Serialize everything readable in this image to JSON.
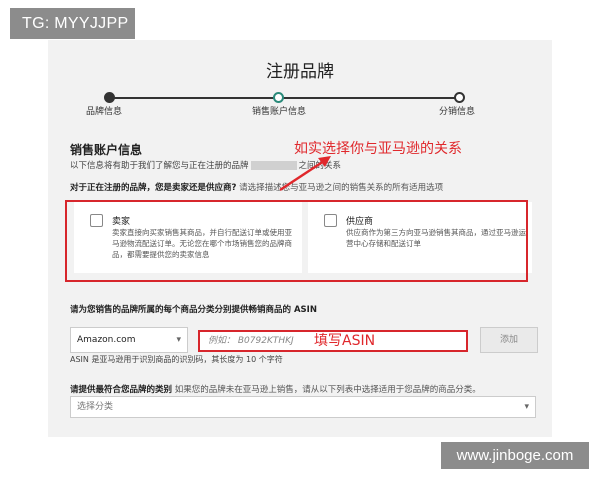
{
  "watermarks": {
    "top": "TG: MYYJJPP",
    "bottom": "www.jinboge.com"
  },
  "page": {
    "title": "注册品牌"
  },
  "stepper": {
    "steps": [
      "品牌信息",
      "销售账户信息",
      "分销信息"
    ]
  },
  "section": {
    "title": "销售账户信息",
    "desc_prefix": "以下信息将有助于我们了解您与正在注册的品牌",
    "desc_suffix": "之间的关系",
    "question_bold": "对于正在注册的品牌，您是卖家还是供应商?",
    "question_sub": "请选择描述您与亚马逊之间的销售关系的所有适用选项"
  },
  "options": {
    "seller": {
      "title": "卖家",
      "desc": "卖家直接向买家销售其商品，并自行配送订单或使用亚马逊物流配送订单。无论您在哪个市场销售您的品牌商品，都需要提供您的卖家信息"
    },
    "vendor": {
      "title": "供应商",
      "desc": "供应商作为第三方向亚马逊销售其商品，通过亚马逊运营中心存储和配送订单"
    }
  },
  "annotations": {
    "relation": "如实选择你与亚马逊的关系",
    "asin": "填写ASIN",
    "color": "#e0282c"
  },
  "asin_section": {
    "title": "请为您销售的品牌所属的每个商品分类分别提供畅销商品的 ASIN",
    "marketplace_value": "Amazon.com",
    "input_placeholder": "例如： B0792KTHKJ",
    "add_label": "添加",
    "hint": "ASIN 是亚马逊用于识别商品的识别码，其长度为 10 个字符"
  },
  "category_section": {
    "title_bold": "请提供最符合您品牌的类别",
    "title_sub": "如果您的品牌未在亚马逊上销售，请从以下列表中选择适用于您品牌的商品分类。",
    "select_placeholder": "选择分类"
  },
  "icons": {
    "chevron": "chevron-down-icon",
    "arrow": "arrow-up-right-icon"
  }
}
